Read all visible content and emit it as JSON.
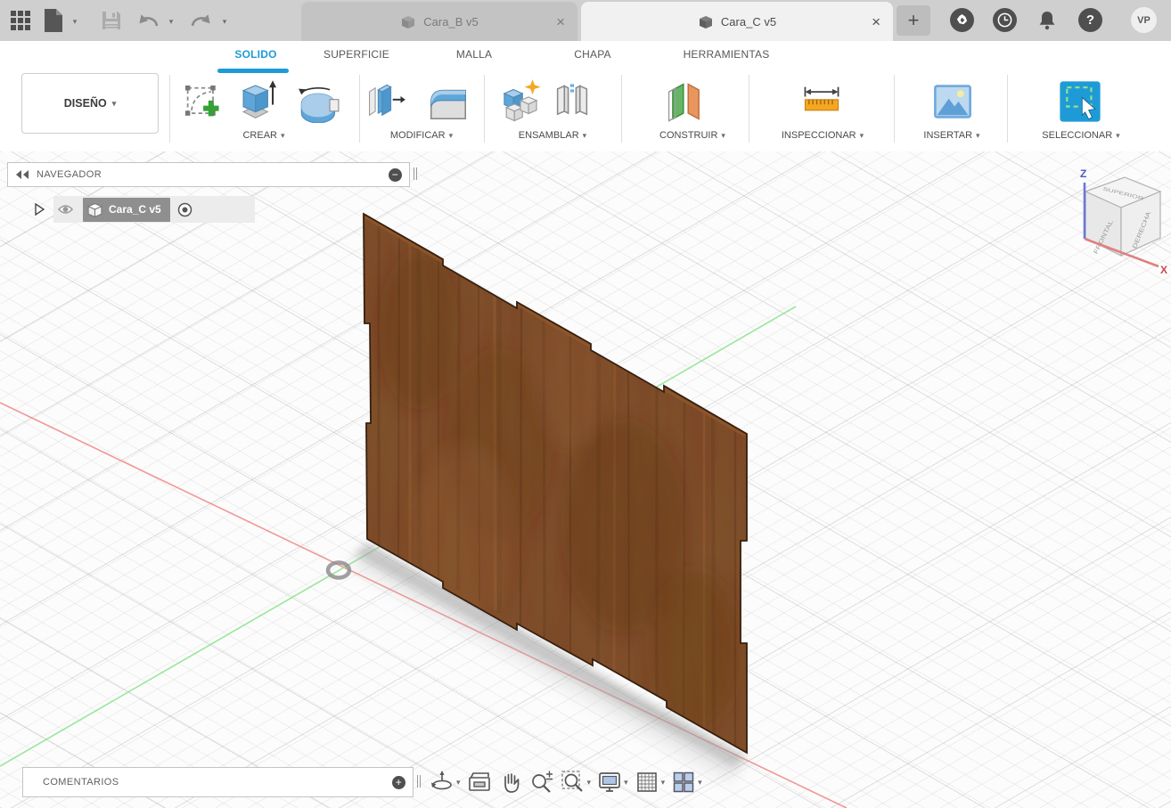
{
  "titlebar": {
    "tabs": [
      {
        "label": "Cara_B v5"
      },
      {
        "label": "Cara_C v5"
      }
    ],
    "close_glyph": "×",
    "new_tab_glyph": "+",
    "help_glyph": "?",
    "avatar_initials": "VP"
  },
  "ribbon": {
    "context_button_label": "DISEÑO",
    "caret_glyph": "▾",
    "tabs": [
      "SOLIDO",
      "SUPERFICIE",
      "MALLA",
      "CHAPA",
      "HERRAMIENTAS"
    ],
    "active_tab": "SOLIDO",
    "accent_color": "#1e9bd7",
    "groups": [
      {
        "label": "CREAR"
      },
      {
        "label": "MODIFICAR"
      },
      {
        "label": "ENSAMBLAR"
      },
      {
        "label": "CONSTRUIR"
      },
      {
        "label": "INSPECCIONAR"
      },
      {
        "label": "INSERTAR"
      },
      {
        "label": "SELECCIONAR"
      }
    ]
  },
  "navigator": {
    "title": "NAVEGADOR",
    "minimize_glyph": "−",
    "item_label": "Cara_C v5"
  },
  "comments": {
    "title": "COMENTARIOS",
    "add_glyph": "+"
  },
  "viewcube": {
    "top_label": "SUPERIOR",
    "front_label": "FRONTAL",
    "right_label": "DERECHA",
    "z_label": "Z",
    "x_label": "X"
  },
  "viewport": {
    "x_axis_color": "#f28b8b",
    "y_axis_color": "#8fe58f",
    "wood_base_color": "#7d4827"
  },
  "bottom_toolbar": {
    "items": [
      "orbit",
      "look-at",
      "pan",
      "zoom",
      "window-zoom",
      "display-settings",
      "grid-settings",
      "viewports"
    ]
  }
}
